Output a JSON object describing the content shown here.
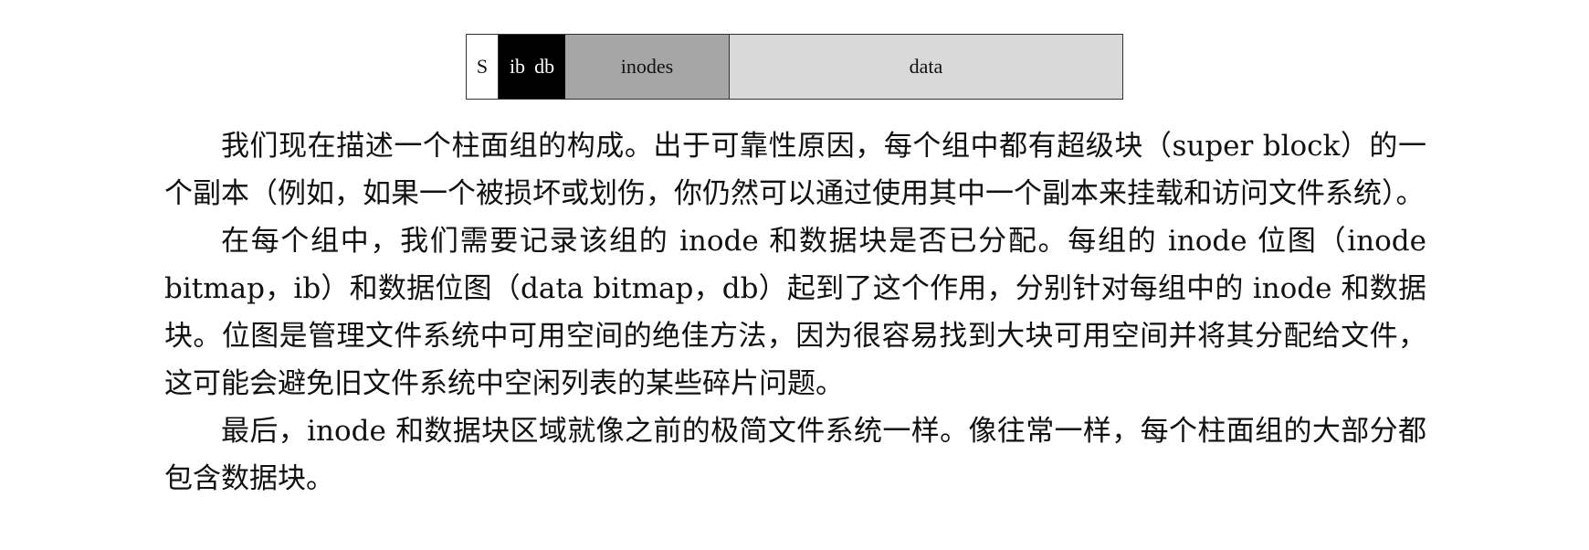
{
  "figure": {
    "segments": {
      "s": "S",
      "ib": "ib",
      "db": "db",
      "inodes": "inodes",
      "data": "data"
    }
  },
  "paragraphs": [
    "我们现在描述一个柱面组的构成。出于可靠性原因，每个组中都有超级块（super block）的一个副本（例如，如果一个被损坏或划伤，你仍然可以通过使用其中一个副本来挂载和访问文件系统）。",
    "在每个组中，我们需要记录该组的 inode 和数据块是否已分配。每组的 inode 位图（inode bitmap，ib）和数据位图（data bitmap，db）起到了这个作用，分别针对每组中的 inode 和数据块。位图是管理文件系统中可用空间的绝佳方法，因为很容易找到大块可用空间并将其分配给文件，这可能会避免旧文件系统中空闲列表的某些碎片问题。",
    "最后，inode 和数据块区域就像之前的极简文件系统一样。像往常一样，每个柱面组的大部分都包含数据块。"
  ]
}
